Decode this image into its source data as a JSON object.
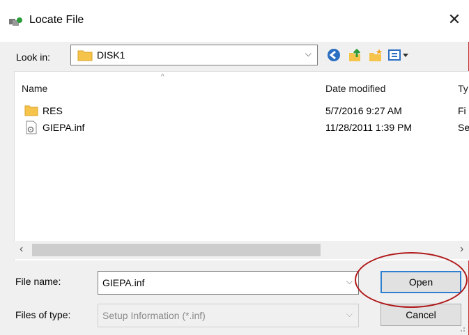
{
  "window": {
    "title": "Locate File",
    "close_glyph": "✕"
  },
  "look_in": {
    "label": "Look in:",
    "value": "DISK1",
    "dropdown_glyph": "⌵"
  },
  "toolbar": {
    "icons": [
      "back-icon",
      "up-folder-icon",
      "new-folder-icon",
      "view-menu-icon"
    ]
  },
  "file_list": {
    "columns": [
      {
        "label": "Name"
      },
      {
        "label": "Date modified"
      },
      {
        "label": "Ty"
      }
    ],
    "sort_glyph": "^",
    "rows": [
      {
        "name": "RES",
        "date": "5/7/2016 9:27 AM",
        "type": "Fi",
        "icon": "folder-icon"
      },
      {
        "name": "GIEPA.inf",
        "date": "11/28/2011 1:39 PM",
        "type": "Se",
        "icon": "setup-file-icon"
      }
    ]
  },
  "scrollbar": {
    "left_glyph": "‹",
    "right_glyph": "›"
  },
  "file_name": {
    "label": "File name:",
    "value": "GIEPA.inf"
  },
  "file_type": {
    "label": "Files of type:",
    "value": "Setup Information (*.inf)"
  },
  "buttons": {
    "open": "Open",
    "cancel": "Cancel"
  },
  "colors": {
    "accent": "#2f7fd1",
    "highlight": "#b01818",
    "folder": "#f7c44b"
  }
}
